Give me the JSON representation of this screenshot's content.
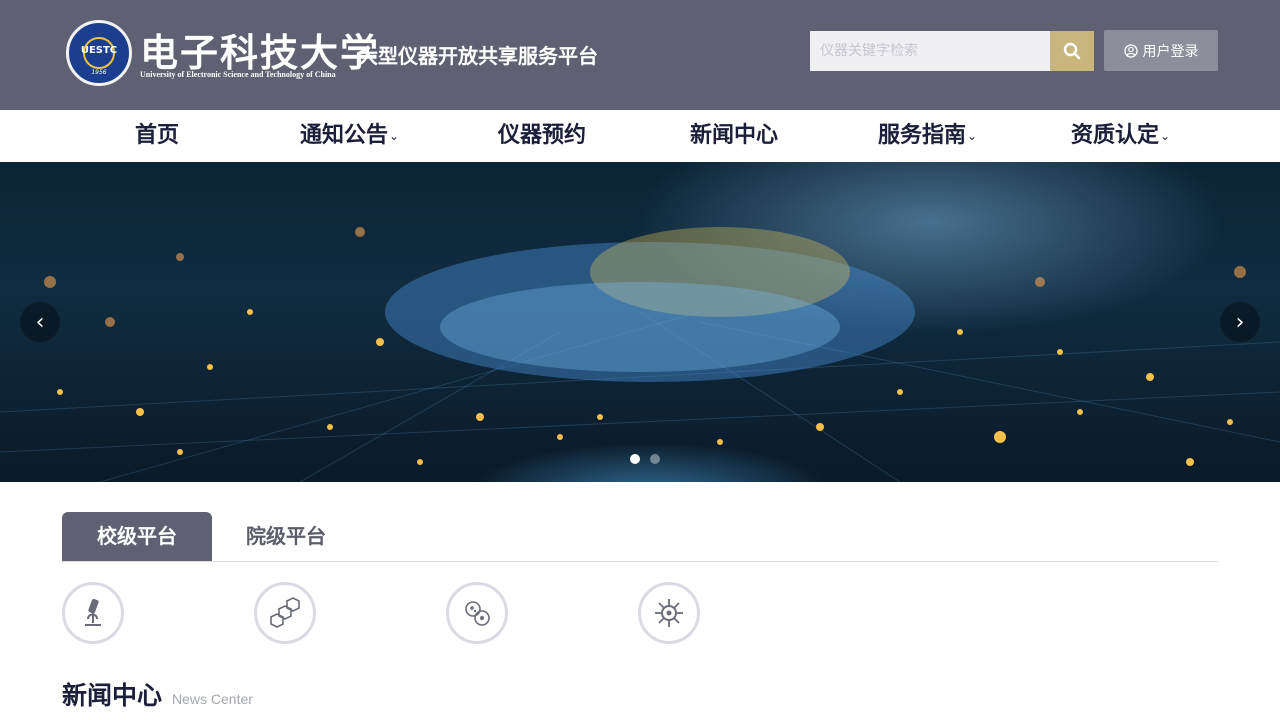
{
  "header": {
    "logo_cn": "电子科技大学",
    "logo_en": "University of Electronic Science and Technology of China",
    "logo_emblem_text": "UESTC",
    "logo_emblem_year": "1956",
    "platform_title": "大型仪器开放共享服务平台",
    "search_placeholder": "仪器关键字检索",
    "search_icon": "search-icon",
    "login_label": "用户登录",
    "login_icon": "user-icon",
    "bg_color": "#5f6173",
    "accent_color": "#c9b67c"
  },
  "nav": {
    "items": [
      {
        "label": "首页",
        "has_dropdown": false
      },
      {
        "label": "通知公告",
        "has_dropdown": true
      },
      {
        "label": "仪器预约",
        "has_dropdown": false
      },
      {
        "label": "新闻中心",
        "has_dropdown": false
      },
      {
        "label": "服务指南",
        "has_dropdown": true
      },
      {
        "label": "资质认定",
        "has_dropdown": true
      }
    ],
    "caret": "⌄"
  },
  "banner": {
    "prev_icon": "chevron-left-icon",
    "next_icon": "chevron-right-icon",
    "prev_glyph": "‹",
    "next_glyph": "›",
    "slide_count": 2,
    "active_slide": 0
  },
  "tabs": [
    {
      "label": "校级平台",
      "active": true
    },
    {
      "label": "院级平台",
      "active": false
    }
  ],
  "platforms": [
    {
      "icon": "microscope-icon"
    },
    {
      "icon": "molecule-icon"
    },
    {
      "icon": "cells-icon"
    },
    {
      "icon": "virus-icon"
    }
  ],
  "news": {
    "title": "新闻中心",
    "subtitle": "News Center"
  }
}
